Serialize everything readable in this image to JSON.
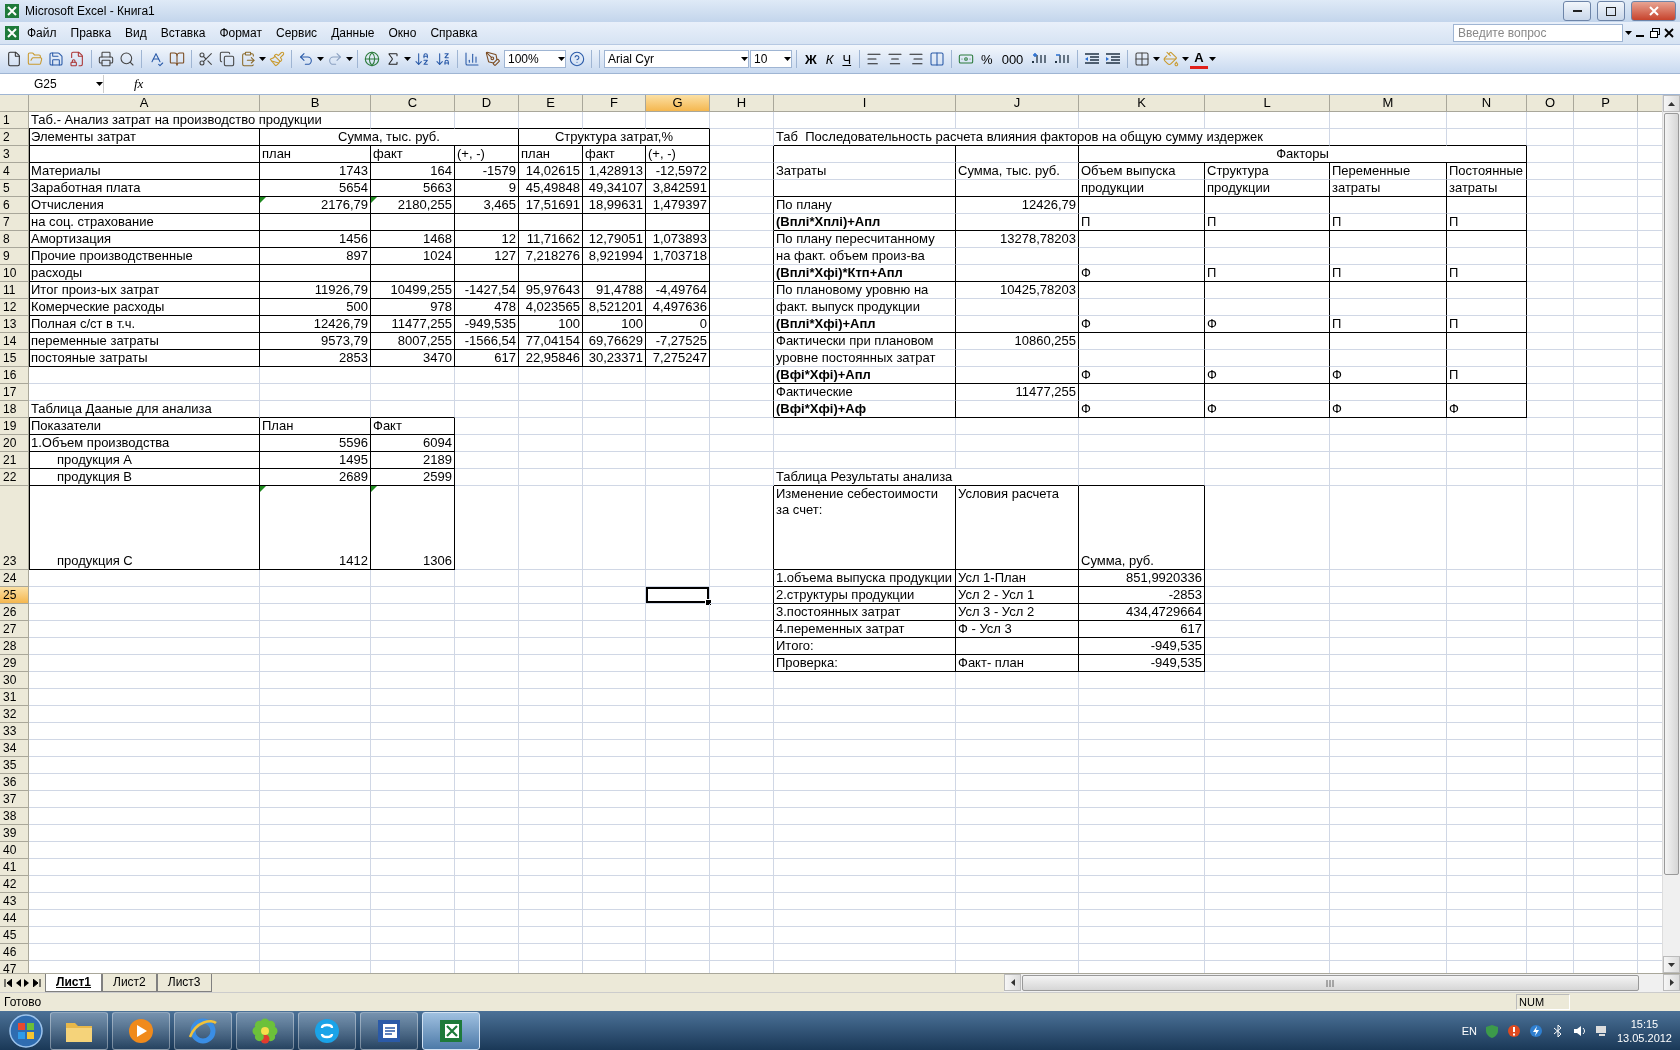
{
  "title_bar": {
    "title": "Microsoft Excel - Книга1"
  },
  "menu": [
    "Файл",
    "Правка",
    "Вид",
    "Вставка",
    "Формат",
    "Сервис",
    "Данные",
    "Окно",
    "Справка"
  ],
  "help_search": {
    "placeholder": "Введите вопрос"
  },
  "toolbar": {
    "zoom": "100%",
    "font": "Arial Cyr",
    "size": "10",
    "bold": "Ж",
    "italic": "К",
    "underline": "Ч",
    "percent": "%",
    "thousands": "000",
    "font_color": "A"
  },
  "formula_bar": {
    "name_box": "G25",
    "fx": "fx"
  },
  "sheet": {
    "columns": [
      {
        "letter": "A",
        "selected": false
      },
      {
        "letter": "B",
        "selected": false
      },
      {
        "letter": "C",
        "selected": false
      },
      {
        "letter": "D",
        "selected": false
      },
      {
        "letter": "E",
        "selected": false
      },
      {
        "letter": "F",
        "selected": false
      },
      {
        "letter": "G",
        "selected": true
      },
      {
        "letter": "H",
        "selected": false
      },
      {
        "letter": "I",
        "selected": false
      },
      {
        "letter": "J",
        "selected": false
      },
      {
        "letter": "K",
        "selected": false
      },
      {
        "letter": "L",
        "selected": false
      },
      {
        "letter": "M",
        "selected": false
      },
      {
        "letter": "N",
        "selected": false
      },
      {
        "letter": "O",
        "selected": false
      },
      {
        "letter": "P",
        "selected": false
      }
    ],
    "rows": [
      {
        "n": "1",
        "selected": false,
        "cells": [
          {
            "text": "Таб.- Анализ затрат на производство продукции",
            "kind": "text"
          }
        ]
      },
      {
        "n": "2",
        "selected": false,
        "cells": [
          {
            "text": "Элементы затрат",
            "kind": "text",
            "boxed": true
          },
          {
            "text": "Сумма, тыс. руб.",
            "kind": "text",
            "boxed": true
          },
          {
            "merged": true
          },
          {
            "merged": true
          },
          {
            "text": "Структура затрат,%",
            "kind": "text",
            "boxed": true
          },
          {
            "merged": true
          },
          {
            "merged": true
          },
          null,
          {
            "text": "Таб  Последовательность расчета влияния факторов на общую сумму издержек",
            "kind": "text"
          }
        ]
      },
      {
        "n": "3",
        "selected": false,
        "cells": [
          {
            "boxed": true
          },
          {
            "text": "план",
            "kind": "text",
            "boxed": true
          },
          {
            "text": "факт",
            "kind": "text",
            "boxed": true
          },
          {
            "text": "(+, -)",
            "kind": "text",
            "boxed": true
          },
          {
            "text": "план",
            "kind": "text",
            "boxed": true
          },
          {
            "text": "факт",
            "kind": "text",
            "boxed": true
          },
          {
            "text": "(+, -)",
            "kind": "text",
            "boxed": true
          },
          null,
          {
            "boxed": true,
            "bottom": false
          },
          {
            "boxed": true,
            "bottom": false
          },
          {
            "text": "Факторы",
            "kind": "text",
            "boxed": true
          },
          {
            "merged": true
          },
          {
            "merged": true
          },
          {
            "merged": true
          }
        ]
      },
      {
        "n": "4",
        "selected": false,
        "cells": [
          {
            "text": "Материалы",
            "kind": "text",
            "boxed": true
          },
          {
            "text": "1743",
            "kind": "number",
            "boxed": true
          },
          {
            "text": "164",
            "kind": "number",
            "boxed": true
          },
          {
            "text": "-1579",
            "kind": "number",
            "boxed": true
          },
          {
            "text": "14,02615",
            "kind": "number",
            "boxed": true
          },
          {
            "text": "1,428913",
            "kind": "number",
            "boxed": true
          },
          {
            "text": "-12,5972",
            "kind": "number",
            "boxed": true
          },
          null,
          {
            "text": "Затраты",
            "kind": "text",
            "boxed": true,
            "top": false,
            "bottom": false
          },
          {
            "text": "Сумма, тыс. руб.",
            "kind": "text",
            "boxed": true,
            "top": false,
            "bottom": false
          },
          {
            "text": "Объем выпуска",
            "kind": "text",
            "boxed": true,
            "bottom": false
          },
          {
            "text": "Структура",
            "kind": "text",
            "boxed": true,
            "bottom": false
          },
          {
            "text": "Переменные",
            "kind": "text",
            "boxed": true,
            "bottom": false
          },
          {
            "text": "Постоянные",
            "kind": "text",
            "boxed": true,
            "bottom": false
          }
        ]
      },
      {
        "n": "5",
        "selected": false,
        "cells": [
          {
            "text": "Заработная плата",
            "kind": "text",
            "boxed": true
          },
          {
            "text": "5654",
            "kind": "number",
            "boxed": true
          },
          {
            "text": "5663",
            "kind": "number",
            "boxed": true
          },
          {
            "text": "9",
            "kind": "number",
            "boxed": true
          },
          {
            "text": "45,49848",
            "kind": "number",
            "boxed": true
          },
          {
            "text": "49,34107",
            "kind": "number",
            "boxed": true
          },
          {
            "text": "3,842591",
            "kind": "number",
            "boxed": true
          },
          null,
          {
            "boxed": true,
            "top": false
          },
          {
            "boxed": true,
            "top": false
          },
          {
            "text": "продукции",
            "kind": "text",
            "boxed": true,
            "top": false
          },
          {
            "text": "продукции",
            "kind": "text",
            "boxed": true,
            "top": false
          },
          {
            "text": "затраты",
            "kind": "text",
            "boxed": true,
            "top": false
          },
          {
            "text": "затраты",
            "kind": "text",
            "boxed": true,
            "top": false
          }
        ]
      },
      {
        "n": "6",
        "selected": false,
        "cells": [
          {
            "text": "Отчисления",
            "kind": "text",
            "boxed": true
          },
          {
            "text": "2176,79",
            "kind": "number",
            "boxed": true,
            "flag": true
          },
          {
            "text": "2180,255",
            "kind": "number",
            "boxed": true,
            "flag": true
          },
          {
            "text": "3,465",
            "kind": "number",
            "boxed": true
          },
          {
            "text": "17,51691",
            "kind": "number",
            "boxed": true
          },
          {
            "text": "18,99631",
            "kind": "number",
            "boxed": true
          },
          {
            "text": "1,479397",
            "kind": "number",
            "boxed": true
          },
          null,
          {
            "text": "По плану",
            "kind": "text",
            "boxed": true,
            "bottom": false
          },
          {
            "text": "12426,79",
            "kind": "number",
            "boxed": true,
            "bottom": false
          },
          {
            "boxed": true,
            "bottom": false
          },
          {
            "boxed": true,
            "bottom": false
          },
          {
            "boxed": true,
            "bottom": false
          },
          {
            "boxed": true,
            "bottom": false
          }
        ]
      },
      {
        "n": "7",
        "selected": false,
        "cells": [
          {
            "text": "на соц. страхование",
            "kind": "text",
            "boxed": true
          },
          {
            "boxed": true
          },
          {
            "boxed": true
          },
          {
            "boxed": true
          },
          {
            "boxed": true
          },
          {
            "boxed": true
          },
          {
            "boxed": true
          },
          null,
          {
            "text": "(Вплi*Хплi)+Апл",
            "kind": "text",
            "boxed": true,
            "top": false,
            "bold": true
          },
          {
            "boxed": true,
            "top": false
          },
          {
            "text": "П",
            "kind": "text",
            "boxed": true,
            "top": false
          },
          {
            "text": "П",
            "kind": "text",
            "boxed": true,
            "top": false
          },
          {
            "text": "П",
            "kind": "text",
            "boxed": true,
            "top": false
          },
          {
            "text": "П",
            "kind": "text",
            "boxed": true,
            "top": false
          }
        ]
      },
      {
        "n": "8",
        "selected": false,
        "cells": [
          {
            "text": "Амортизация",
            "kind": "text",
            "boxed": true
          },
          {
            "text": "1456",
            "kind": "number",
            "boxed": true
          },
          {
            "text": "1468",
            "kind": "number",
            "boxed": true
          },
          {
            "text": "12",
            "kind": "number",
            "boxed": true
          },
          {
            "text": "11,71662",
            "kind": "number",
            "boxed": true
          },
          {
            "text": "12,79051",
            "kind": "number",
            "boxed": true
          },
          {
            "text": "1,073893",
            "kind": "number",
            "boxed": true
          },
          null,
          {
            "text": "По плану пересчитанному",
            "kind": "text",
            "boxed": true,
            "bottom": false
          },
          {
            "text": "13278,78203",
            "kind": "number",
            "boxed": true,
            "bottom": false
          },
          {
            "boxed": true,
            "bottom": false
          },
          {
            "boxed": true,
            "bottom": false
          },
          {
            "boxed": true,
            "bottom": false
          },
          {
            "boxed": true,
            "bottom": false
          }
        ]
      },
      {
        "n": "9",
        "selected": false,
        "cells": [
          {
            "text": "Прочие производственные",
            "kind": "text",
            "boxed": true
          },
          {
            "text": "897",
            "kind": "number",
            "boxed": true
          },
          {
            "text": "1024",
            "kind": "number",
            "boxed": true
          },
          {
            "text": "127",
            "kind": "number",
            "boxed": true
          },
          {
            "text": "7,218276",
            "kind": "number",
            "boxed": true
          },
          {
            "text": "8,921994",
            "kind": "number",
            "boxed": true
          },
          {
            "text": "1,703718",
            "kind": "number",
            "boxed": true
          },
          null,
          {
            "text": "на факт. объем произ-ва",
            "kind": "text",
            "boxed": true,
            "top": false,
            "bottom": false
          },
          {
            "boxed": true,
            "top": false,
            "bottom": false
          },
          {
            "boxed": true,
            "top": false,
            "bottom": false
          },
          {
            "boxed": true,
            "top": false,
            "bottom": false
          },
          {
            "boxed": true,
            "top": false,
            "bottom": false
          },
          {
            "boxed": true,
            "top": false,
            "bottom": false
          }
        ]
      },
      {
        "n": "10",
        "selected": false,
        "cells": [
          {
            "text": "расходы",
            "kind": "text",
            "boxed": true
          },
          {
            "boxed": true
          },
          {
            "boxed": true
          },
          {
            "boxed": true
          },
          {
            "boxed": true
          },
          {
            "boxed": true
          },
          {
            "boxed": true
          },
          null,
          {
            "text": "(Вплi*Хфi)*Ктп+Апл",
            "kind": "text",
            "boxed": true,
            "top": false,
            "bold": true
          },
          {
            "boxed": true,
            "top": false
          },
          {
            "text": "Ф",
            "kind": "text",
            "boxed": true,
            "top": false
          },
          {
            "text": "П",
            "kind": "text",
            "boxed": true,
            "top": false
          },
          {
            "text": "П",
            "kind": "text",
            "boxed": true,
            "top": false
          },
          {
            "text": "П",
            "kind": "text",
            "boxed": true,
            "top": false
          }
        ]
      },
      {
        "n": "11",
        "selected": false,
        "cells": [
          {
            "text": "Итог произ-ых затрат",
            "kind": "text",
            "boxed": true
          },
          {
            "text": "11926,79",
            "kind": "number",
            "boxed": true
          },
          {
            "text": "10499,255",
            "kind": "number",
            "boxed": true
          },
          {
            "text": "-1427,54",
            "kind": "number",
            "boxed": true
          },
          {
            "text": "95,97643",
            "kind": "number",
            "boxed": true
          },
          {
            "text": "91,4788",
            "kind": "number",
            "boxed": true
          },
          {
            "text": "-4,49764",
            "kind": "number",
            "boxed": true
          },
          null,
          {
            "text": "По плановому уровню на",
            "kind": "text",
            "boxed": true,
            "bottom": false
          },
          {
            "text": "10425,78203",
            "kind": "number",
            "boxed": true,
            "bottom": false
          },
          {
            "boxed": true,
            "bottom": false
          },
          {
            "boxed": true,
            "bottom": false
          },
          {
            "boxed": true,
            "bottom": false
          },
          {
            "boxed": true,
            "bottom": false
          }
        ]
      },
      {
        "n": "12",
        "selected": false,
        "cells": [
          {
            "text": "Комерческие расходы",
            "kind": "text",
            "boxed": true
          },
          {
            "text": "500",
            "kind": "number",
            "boxed": true
          },
          {
            "text": "978",
            "kind": "number",
            "boxed": true
          },
          {
            "text": "478",
            "kind": "number",
            "boxed": true
          },
          {
            "text": "4,023565",
            "kind": "number",
            "boxed": true
          },
          {
            "text": "8,521201",
            "kind": "number",
            "boxed": true
          },
          {
            "text": "4,497636",
            "kind": "number",
            "boxed": true
          },
          null,
          {
            "text": "факт. выпуск продукции",
            "kind": "text",
            "boxed": true,
            "top": false,
            "bottom": false
          },
          {
            "boxed": true,
            "top": false,
            "bottom": false
          },
          {
            "boxed": true,
            "top": false,
            "bottom": false
          },
          {
            "boxed": true,
            "top": false,
            "bottom": false
          },
          {
            "boxed": true,
            "top": false,
            "bottom": false
          },
          {
            "boxed": true,
            "top": false,
            "bottom": false
          }
        ]
      },
      {
        "n": "13",
        "selected": false,
        "cells": [
          {
            "text": "Полная с/ст в т.ч.",
            "kind": "text",
            "boxed": true
          },
          {
            "text": "12426,79",
            "kind": "number",
            "boxed": true
          },
          {
            "text": "11477,255",
            "kind": "number",
            "boxed": true
          },
          {
            "text": "-949,535",
            "kind": "number",
            "boxed": true
          },
          {
            "text": "100",
            "kind": "number",
            "boxed": true
          },
          {
            "text": "100",
            "kind": "number",
            "boxed": true
          },
          {
            "text": "0",
            "kind": "number",
            "boxed": true
          },
          null,
          {
            "text": "(Вплi*Хфi)+Апл",
            "kind": "text",
            "boxed": true,
            "top": false,
            "bold": true
          },
          {
            "boxed": true,
            "top": false
          },
          {
            "text": "Ф",
            "kind": "text",
            "boxed": true,
            "top": false
          },
          {
            "text": "Ф",
            "kind": "text",
            "boxed": true,
            "top": false
          },
          {
            "text": "П",
            "kind": "text",
            "boxed": true,
            "top": false
          },
          {
            "text": "П",
            "kind": "text",
            "boxed": true,
            "top": false
          }
        ]
      },
      {
        "n": "14",
        "selected": false,
        "cells": [
          {
            "text": "переменные затраты",
            "kind": "text",
            "boxed": true
          },
          {
            "text": "9573,79",
            "kind": "number",
            "boxed": true
          },
          {
            "text": "8007,255",
            "kind": "number",
            "boxed": true
          },
          {
            "text": "-1566,54",
            "kind": "number",
            "boxed": true
          },
          {
            "text": "77,04154",
            "kind": "number",
            "boxed": true
          },
          {
            "text": "69,76629",
            "kind": "number",
            "boxed": true
          },
          {
            "text": "-7,27525",
            "kind": "number",
            "boxed": true
          },
          null,
          {
            "text": "Фактически при плановом",
            "kind": "text",
            "boxed": true,
            "bottom": false
          },
          {
            "text": "10860,255",
            "kind": "number",
            "boxed": true,
            "bottom": false
          },
          {
            "boxed": true,
            "bottom": false
          },
          {
            "boxed": true,
            "bottom": false
          },
          {
            "boxed": true,
            "bottom": false
          },
          {
            "boxed": true,
            "bottom": false
          }
        ]
      },
      {
        "n": "15",
        "selected": false,
        "cells": [
          {
            "text": "постояные затраты",
            "kind": "text",
            "boxed": true
          },
          {
            "text": "2853",
            "kind": "number",
            "boxed": true
          },
          {
            "text": "3470",
            "kind": "number",
            "boxed": true
          },
          {
            "text": "617",
            "kind": "number",
            "boxed": true
          },
          {
            "text": "22,95846",
            "kind": "number",
            "boxed": true
          },
          {
            "text": "30,23371",
            "kind": "number",
            "boxed": true
          },
          {
            "text": "7,275247",
            "kind": "number",
            "boxed": true
          },
          null,
          {
            "text": "уровне постоянных затрат",
            "kind": "text",
            "boxed": true,
            "top": false,
            "bottom": false
          },
          {
            "boxed": true,
            "top": false,
            "bottom": false
          },
          {
            "boxed": true,
            "top": false,
            "bottom": false
          },
          {
            "boxed": true,
            "top": false,
            "bottom": false
          },
          {
            "boxed": true,
            "top": false,
            "bottom": false
          },
          {
            "boxed": true,
            "top": false,
            "bottom": false
          }
        ]
      },
      {
        "n": "16",
        "selected": false,
        "cells": [
          null,
          null,
          null,
          null,
          null,
          null,
          null,
          null,
          {
            "text": "(Вфi*Хфi)+Апл",
            "kind": "text",
            "boxed": true,
            "top": false,
            "bold": true
          },
          {
            "boxed": true,
            "top": false
          },
          {
            "text": "Ф",
            "kind": "text",
            "boxed": true,
            "top": false
          },
          {
            "text": "Ф",
            "kind": "text",
            "boxed": true,
            "top": false
          },
          {
            "text": "Ф",
            "kind": "text",
            "boxed": true,
            "top": false
          },
          {
            "text": "П",
            "kind": "text",
            "boxed": true,
            "top": false
          }
        ]
      },
      {
        "n": "17",
        "selected": false,
        "cells": [
          null,
          null,
          null,
          null,
          null,
          null,
          null,
          null,
          {
            "text": "Фактические",
            "kind": "text",
            "boxed": true,
            "bottom": false
          },
          {
            "text": "11477,255",
            "kind": "number",
            "boxed": true,
            "bottom": false
          },
          {
            "boxed": true,
            "bottom": false
          },
          {
            "boxed": true,
            "bottom": false
          },
          {
            "boxed": true,
            "bottom": false
          },
          {
            "boxed": true,
            "bottom": false
          }
        ]
      },
      {
        "n": "18",
        "selected": false,
        "cells": [
          {
            "text": "Таблица Дааные для анализа",
            "kind": "text"
          },
          null,
          null,
          null,
          null,
          null,
          null,
          null,
          {
            "text": "(Вфi*Хфi)+Аф",
            "kind": "text",
            "boxed": true,
            "top": false,
            "bold": true
          },
          {
            "boxed": true,
            "top": false
          },
          {
            "text": "Ф",
            "kind": "text",
            "boxed": true,
            "top": false
          },
          {
            "text": "Ф",
            "kind": "text",
            "boxed": true,
            "top": false
          },
          {
            "text": "Ф",
            "kind": "text",
            "boxed": true,
            "top": false
          },
          {
            "text": "Ф",
            "kind": "text",
            "boxed": true,
            "top": false
          }
        ]
      },
      {
        "n": "19",
        "selected": false,
        "cells": [
          {
            "text": "Показатели",
            "kind": "text",
            "boxed": true
          },
          {
            "text": "План",
            "kind": "text",
            "boxed": true
          },
          {
            "text": "Факт",
            "kind": "text",
            "boxed": true
          }
        ]
      },
      {
        "n": "20",
        "selected": false,
        "cells": [
          {
            "text": "1.Объем производства",
            "kind": "text",
            "boxed": true
          },
          {
            "text": "5596",
            "kind": "number",
            "boxed": true
          },
          {
            "text": "6094",
            "kind": "number",
            "boxed": true
          }
        ]
      },
      {
        "n": "21",
        "selected": false,
        "cells": [
          {
            "text": "продукция А",
            "kind": "text",
            "boxed": true,
            "indent": true
          },
          {
            "text": "1495",
            "kind": "number",
            "boxed": true
          },
          {
            "text": "2189",
            "kind": "number",
            "boxed": true
          }
        ]
      },
      {
        "n": "22",
        "selected": false,
        "cells": [
          {
            "text": "продукция В",
            "kind": "text",
            "boxed": true,
            "indent": true
          },
          {
            "text": "2689",
            "kind": "number",
            "boxed": true
          },
          {
            "text": "2599",
            "kind": "number",
            "boxed": true
          },
          null,
          null,
          null,
          null,
          null,
          {
            "text": "Таблица Результаты анализа",
            "kind": "text"
          }
        ]
      },
      {
        "n": "23",
        "selected": false,
        "tall": true,
        "cells": [
          {
            "text": "продукция С",
            "kind": "text",
            "boxed": true,
            "indent": true
          },
          {
            "text": "1412",
            "kind": "number",
            "boxed": true,
            "flag": true
          },
          {
            "text": "1306",
            "kind": "number",
            "boxed": true,
            "flag": true
          },
          null,
          null,
          null,
          null,
          null,
          {
            "text": "Изменение себестоимости за счет:",
            "kind": "text",
            "boxed": true,
            "wrap": true
          },
          {
            "text": "Условия расчета",
            "kind": "text",
            "boxed": true,
            "wrap": true
          },
          {
            "text": "Сумма, руб.",
            "kind": "text",
            "boxed": true
          }
        ]
      },
      {
        "n": "24",
        "selected": false,
        "cells": [
          null,
          null,
          null,
          null,
          null,
          null,
          null,
          null,
          {
            "text": "1.объема выпуска продукции",
            "kind": "text",
            "boxed": true
          },
          {
            "text": "Усл 1-План",
            "kind": "text",
            "boxed": true
          },
          {
            "text": "851,9920336",
            "kind": "number",
            "boxed": true
          }
        ]
      },
      {
        "n": "25",
        "selected": true,
        "cells": [
          null,
          null,
          null,
          null,
          null,
          null,
          {
            "selected": true
          },
          null,
          {
            "text": "2.структуры продукции",
            "kind": "text",
            "boxed": true
          },
          {
            "text": "Усл 2 - Усл 1",
            "kind": "text",
            "boxed": true
          },
          {
            "text": "-2853",
            "kind": "number",
            "boxed": true
          }
        ]
      },
      {
        "n": "26",
        "selected": false,
        "cells": [
          null,
          null,
          null,
          null,
          null,
          null,
          null,
          null,
          {
            "text": "3.постоянных затрат",
            "kind": "text",
            "boxed": true
          },
          {
            "text": "Усл 3 - Усл 2",
            "kind": "text",
            "boxed": true
          },
          {
            "text": "434,4729664",
            "kind": "number",
            "boxed": true
          }
        ]
      },
      {
        "n": "27",
        "selected": false,
        "cells": [
          null,
          null,
          null,
          null,
          null,
          null,
          null,
          null,
          {
            "text": "4.переменных затрат",
            "kind": "text",
            "boxed": true
          },
          {
            "text": "Ф - Усл 3",
            "kind": "text",
            "boxed": true
          },
          {
            "text": "617",
            "kind": "number",
            "boxed": true
          }
        ]
      },
      {
        "n": "28",
        "selected": false,
        "cells": [
          null,
          null,
          null,
          null,
          null,
          null,
          null,
          null,
          {
            "text": "Итого:",
            "kind": "text",
            "boxed": true
          },
          {
            "boxed": true
          },
          {
            "text": "-949,535",
            "kind": "number",
            "boxed": true
          }
        ]
      },
      {
        "n": "29",
        "selected": false,
        "cells": [
          null,
          null,
          null,
          null,
          null,
          null,
          null,
          null,
          {
            "text": "Проверка:",
            "kind": "text",
            "boxed": true
          },
          {
            "text": "Факт- план",
            "kind": "text",
            "boxed": true
          },
          {
            "text": "-949,535",
            "kind": "number",
            "boxed": true
          }
        ]
      },
      {
        "n": "30",
        "selected": false
      },
      {
        "n": "31",
        "selected": false
      },
      {
        "n": "32",
        "selected": false
      },
      {
        "n": "33",
        "selected": false
      },
      {
        "n": "34",
        "selected": false
      },
      {
        "n": "35",
        "selected": false
      },
      {
        "n": "36",
        "selected": false
      },
      {
        "n": "37",
        "selected": false
      },
      {
        "n": "38",
        "selected": false
      },
      {
        "n": "39",
        "selected": false
      },
      {
        "n": "40",
        "selected": false
      },
      {
        "n": "41",
        "selected": false
      },
      {
        "n": "42",
        "selected": false
      },
      {
        "n": "43",
        "selected": false
      },
      {
        "n": "44",
        "selected": false
      },
      {
        "n": "45",
        "selected": false
      },
      {
        "n": "46",
        "selected": false
      },
      {
        "n": "47",
        "selected": false
      }
    ]
  },
  "sheet_tabs": [
    {
      "label": "Лист1",
      "selected": true
    },
    {
      "label": "Лист2",
      "selected": false
    },
    {
      "label": "Лист3",
      "selected": false
    }
  ],
  "status_bar": {
    "text": "Готово",
    "indicator": "NUM"
  },
  "taskbar": {
    "apps": [
      {
        "kind": "explorer",
        "selected": false
      },
      {
        "kind": "media",
        "selected": false
      },
      {
        "kind": "browser",
        "selected": false
      },
      {
        "kind": "messenger",
        "selected": false
      },
      {
        "kind": "phone",
        "selected": false
      },
      {
        "kind": "word",
        "selected": false
      },
      {
        "kind": "excel",
        "selected": true
      }
    ],
    "language": "EN",
    "time": "15:15",
    "date": "13.05.2012"
  }
}
